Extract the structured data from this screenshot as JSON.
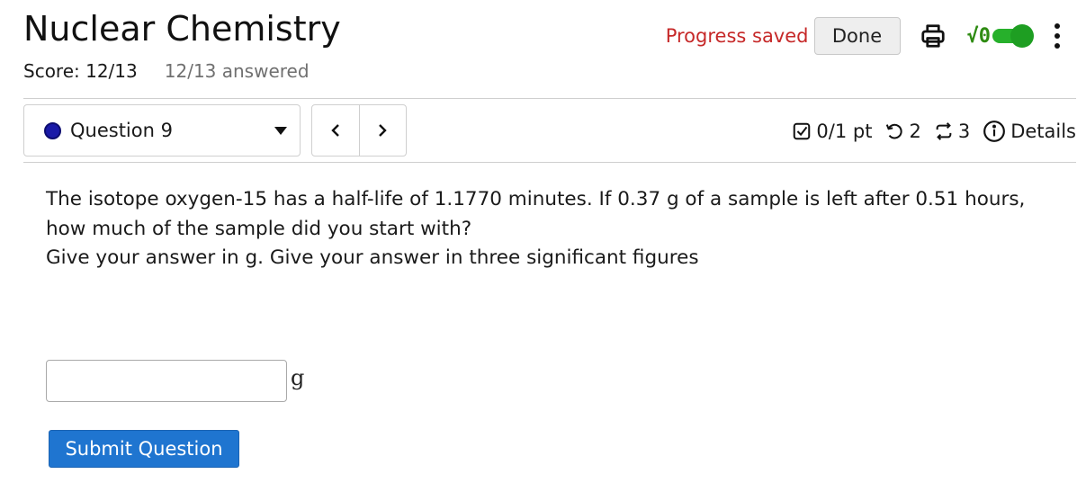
{
  "header": {
    "title": "Nuclear Chemistry",
    "score": "Score: 12/13",
    "answered": "12/13 answered",
    "progress_status": "Progress saved",
    "done_label": "Done",
    "math_toggle_label": "√0",
    "math_toggle_on": true
  },
  "question_nav": {
    "selected_question": "Question 9",
    "prev_label": "‹",
    "next_label": "›",
    "points": "0/1 pt",
    "retries": "2",
    "attempts": "3",
    "details_label": "Details"
  },
  "question": {
    "lines": [
      "The isotope oxygen-15 has a half-life of 1.1770 minutes. If 0.37 g of a sample is left after 0.51 hours,",
      "how much of the sample did you start with?",
      "Give your answer in g. Give your answer in three significant figures"
    ],
    "answer_value": "",
    "unit": "g",
    "submit_label": "Submit Question"
  },
  "colors": {
    "progress_saved": "#c62828",
    "toggle_on": "#27b02b",
    "submit": "#1f75d0",
    "question_dot": "#1a1aa8"
  }
}
